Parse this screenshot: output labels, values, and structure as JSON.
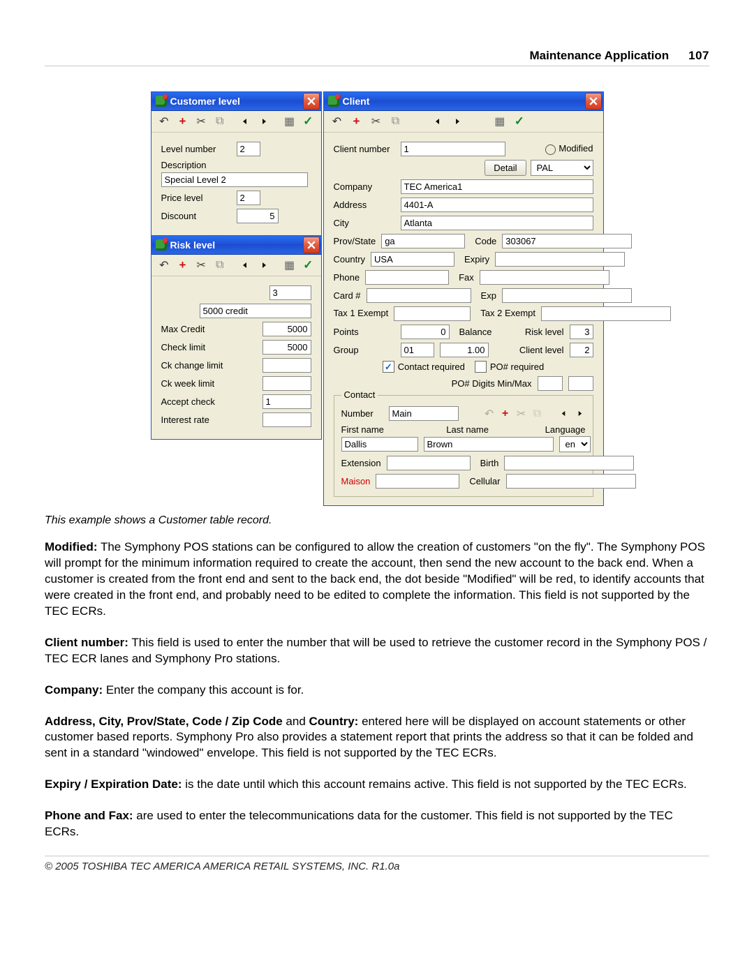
{
  "header": {
    "title": "Maintenance Application",
    "page": "107"
  },
  "windows": {
    "customer_level": {
      "title": "Customer level",
      "fields": {
        "level_number_label": "Level number",
        "level_number_value": "2",
        "description_label": "Description",
        "description_value": "Special Level 2",
        "price_level_label": "Price level",
        "price_level_value": "2",
        "discount_label": "Discount",
        "discount_value": "5"
      }
    },
    "risk_level": {
      "title": "Risk level",
      "fields": {
        "index_value": "3",
        "desc_value": "5000 credit",
        "max_credit_label": "Max Credit",
        "max_credit_value": "5000",
        "check_limit_label": "Check limit",
        "check_limit_value": "5000",
        "ck_change_label": "Ck change limit",
        "ck_change_value": "",
        "ck_week_label": "Ck week limit",
        "ck_week_value": "",
        "accept_check_label": "Accept check",
        "accept_check_value": "1",
        "interest_rate_label": "Interest rate",
        "interest_rate_value": ""
      }
    },
    "client": {
      "title": "Client",
      "client_number_label": "Client number",
      "client_number_value": "1",
      "modified_label": "Modified",
      "detail_btn": "Detail",
      "pal_options": [
        "PAL"
      ],
      "pal_selected": "PAL",
      "company_label": "Company",
      "company_value": "TEC America1",
      "address_label": "Address",
      "address_value": "4401-A",
      "city_label": "City",
      "city_value": "Atlanta",
      "prov_label": "Prov/State",
      "prov_value": "ga",
      "code_label": "Code",
      "code_value": "303067",
      "country_label": "Country",
      "country_value": "USA",
      "expiry_label": "Expiry",
      "expiry_value": "",
      "phone_label": "Phone",
      "phone_value": "",
      "fax_label": "Fax",
      "fax_value": "",
      "card_label": "Card #",
      "card_value": "",
      "exp_label": "Exp",
      "exp_value": "",
      "tax1_label": "Tax 1 Exempt",
      "tax1_value": "",
      "tax2_label": "Tax 2 Exempt",
      "tax2_value": "",
      "points_label": "Points",
      "points_value": "0",
      "balance_label": "Balance",
      "risk_level_label": "Risk level",
      "risk_level_value": "3",
      "group_label": "Group",
      "group_value": "01",
      "group_rate_value": "1.00",
      "client_level_label": "Client level",
      "client_level_value": "2",
      "contact_required_label": "Contact required",
      "po_required_label": "PO# required",
      "po_digits_label": "PO# Digits  Min/Max",
      "po_min_value": "",
      "po_max_value": "",
      "contact": {
        "legend": "Contact",
        "number_label": "Number",
        "number_value": "Main",
        "first_name_label": "First name",
        "first_name_value": "Dallis",
        "last_name_label": "Last name",
        "last_name_value": "Brown",
        "language_label": "Language",
        "language_options": [
          "en"
        ],
        "language_selected": "en",
        "extension_label": "Extension",
        "extension_value": "",
        "birth_label": "Birth",
        "birth_value": "",
        "maison_label": "Maison",
        "maison_value": "",
        "cellular_label": "Cellular",
        "cellular_value": ""
      }
    }
  },
  "caption": "This example shows a Customer table record.",
  "paragraphs": {
    "modified_label": "Modified:",
    "modified_text": " The Symphony POS stations can be configured to allow the creation of customers \"on the fly\". The Symphony POS will prompt for the minimum information required to create the account, then send the new account to the back end. When a customer is created from the front end and sent to the back end, the dot beside \"Modified\" will be red, to identify accounts that were created in the front end, and probably need to be edited to complete the information. This field is not supported by the TEC ECRs.",
    "client_no_label": "Client  number:",
    "client_no_text": " This field is used to enter the number that will be used to retrieve the customer record in the Symphony POS / TEC ECR lanes and Symphony Pro stations.",
    "company_label": "Company:",
    "company_text": " Enter the company this account is for.",
    "address_label": "Address, City, Prov/State, Code / Zip Code",
    "address_mid": " and ",
    "address_label2": "Country:",
    "address_text": " entered here will be displayed on account statements or other customer based reports. Symphony Pro also provides a statement report that prints the address so that it can be folded and sent in a standard \"windowed\" envelope. This field is not supported by the TEC ECRs.",
    "expiry_label": "Expiry / Expiration Date:",
    "expiry_text": " is the date until which this account remains active. This field is not supported by the TEC ECRs.",
    "phone_label": "Phone and Fax:",
    "phone_text": " are used to enter the telecommunications data for the customer. This field is not supported by the TEC ECRs."
  },
  "footer": "© 2005 TOSHIBA TEC AMERICA AMERICA RETAIL SYSTEMS, INC.   R1.0a"
}
